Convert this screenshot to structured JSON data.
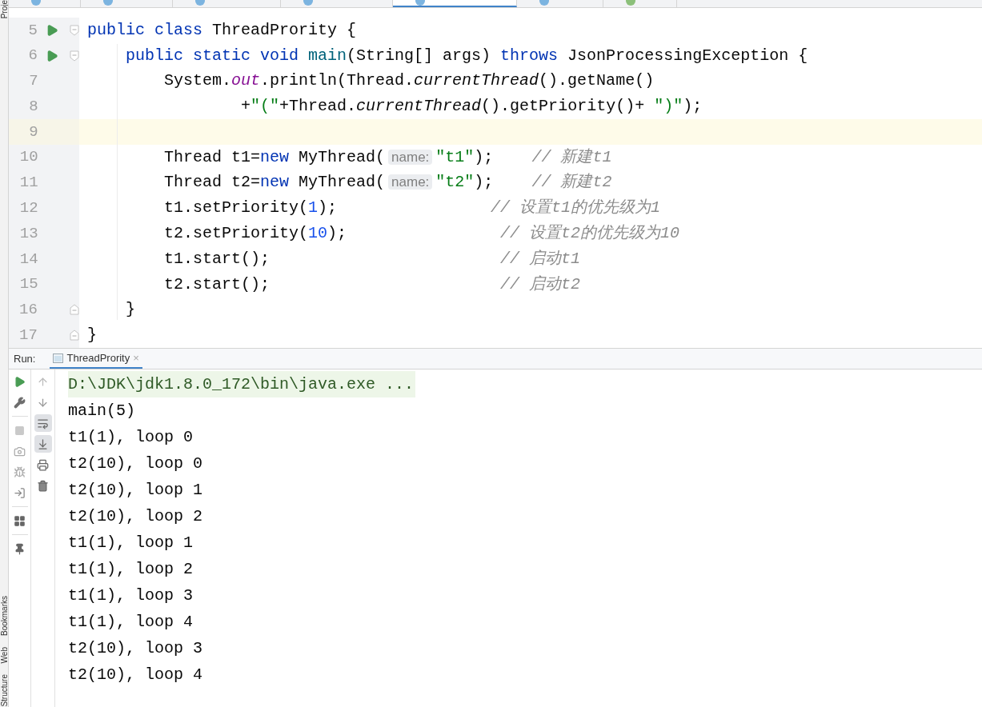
{
  "side_labels_top": [
    {
      "text": "Proje"
    }
  ],
  "side_labels_bottom": [
    {
      "text": "Bookmarks"
    },
    {
      "text": "Web"
    },
    {
      "text": "Structure"
    }
  ],
  "editor_tabs": [
    {
      "selected": false,
      "color": "#7cb4e0"
    },
    {
      "selected": false,
      "color": "#7cb4e0"
    },
    {
      "selected": false,
      "color": "#7cb4e0"
    },
    {
      "selected": false,
      "color": "#7cb4e0"
    },
    {
      "selected": true,
      "color": "#7cb4e0"
    },
    {
      "selected": false,
      "color": "#7cb4e0"
    },
    {
      "selected": false,
      "color": "#8cc07a"
    }
  ],
  "code_lines": [
    {
      "number": "5",
      "current": false,
      "run": true,
      "fold_open": true,
      "fold_close": false,
      "tokens": [
        {
          "kind": "keyword",
          "text": "public class "
        },
        {
          "kind": "plain",
          "text": "ThreadPrority {"
        }
      ]
    },
    {
      "number": "6",
      "current": false,
      "run": true,
      "fold_open": true,
      "fold_close": false,
      "tokens": [
        {
          "kind": "keyword",
          "text": "    public static void "
        },
        {
          "kind": "method",
          "text": "main"
        },
        {
          "kind": "plain",
          "text": "(String[] args) "
        },
        {
          "kind": "keyword",
          "text": "throws"
        },
        {
          "kind": "plain",
          "text": " JsonProcessingException {"
        }
      ]
    },
    {
      "number": "7",
      "current": false,
      "run": false,
      "fold_open": false,
      "fold_close": false,
      "tokens": [
        {
          "kind": "plain",
          "text": "        System."
        },
        {
          "kind": "field",
          "text": "out"
        },
        {
          "kind": "plain",
          "text": ".println(Thread."
        },
        {
          "kind": "static",
          "text": "currentThread"
        },
        {
          "kind": "plain",
          "text": "().getName()"
        }
      ]
    },
    {
      "number": "8",
      "current": false,
      "run": false,
      "fold_open": false,
      "fold_close": false,
      "tokens": [
        {
          "kind": "plain",
          "text": "                +"
        },
        {
          "kind": "string",
          "text": "\"(\""
        },
        {
          "kind": "plain",
          "text": "+Thread."
        },
        {
          "kind": "static",
          "text": "currentThread"
        },
        {
          "kind": "plain",
          "text": "().getPriority()+ "
        },
        {
          "kind": "string",
          "text": "\")\""
        },
        {
          "kind": "plain",
          "text": ");"
        }
      ]
    },
    {
      "number": "9",
      "current": true,
      "run": false,
      "fold_open": false,
      "fold_close": false
    },
    {
      "number": "10",
      "current": false,
      "run": false,
      "fold_open": false,
      "fold_close": false,
      "tokens": [
        {
          "kind": "plain",
          "text": "        Thread t1="
        },
        {
          "kind": "keyword",
          "text": "new "
        },
        {
          "kind": "plain",
          "text": "MyThread("
        },
        {
          "kind": "hint",
          "text": "name:"
        },
        {
          "kind": "string",
          "text": "\"t1\""
        },
        {
          "kind": "plain",
          "text": ");    "
        },
        {
          "kind": "comment",
          "text": "// 新建t1"
        }
      ]
    },
    {
      "number": "11",
      "current": false,
      "run": false,
      "fold_open": false,
      "fold_close": false,
      "tokens": [
        {
          "kind": "plain",
          "text": "        Thread t2="
        },
        {
          "kind": "keyword",
          "text": "new "
        },
        {
          "kind": "plain",
          "text": "MyThread("
        },
        {
          "kind": "hint",
          "text": "name:"
        },
        {
          "kind": "string",
          "text": "\"t2\""
        },
        {
          "kind": "plain",
          "text": ");    "
        },
        {
          "kind": "comment",
          "text": "// 新建t2"
        }
      ]
    },
    {
      "number": "12",
      "current": false,
      "run": false,
      "fold_open": false,
      "fold_close": false,
      "tokens": [
        {
          "kind": "plain",
          "text": "        t1.setPriority("
        },
        {
          "kind": "number",
          "text": "1"
        },
        {
          "kind": "plain",
          "text": ");                "
        },
        {
          "kind": "comment",
          "text": "// 设置t1的优先级为1"
        }
      ]
    },
    {
      "number": "13",
      "current": false,
      "run": false,
      "fold_open": false,
      "fold_close": false,
      "tokens": [
        {
          "kind": "plain",
          "text": "        t2.setPriority("
        },
        {
          "kind": "number",
          "text": "10"
        },
        {
          "kind": "plain",
          "text": ");                "
        },
        {
          "kind": "comment",
          "text": "// 设置t2的优先级为10"
        }
      ]
    },
    {
      "number": "14",
      "current": false,
      "run": false,
      "fold_open": false,
      "fold_close": false,
      "tokens": [
        {
          "kind": "plain",
          "text": "        t1.start();                        "
        },
        {
          "kind": "comment",
          "text": "// 启动t1"
        }
      ]
    },
    {
      "number": "15",
      "current": false,
      "run": false,
      "fold_open": false,
      "fold_close": false,
      "tokens": [
        {
          "kind": "plain",
          "text": "        t2.start();                        "
        },
        {
          "kind": "comment",
          "text": "// 启动t2"
        }
      ]
    },
    {
      "number": "16",
      "current": false,
      "run": false,
      "fold_open": false,
      "fold_close": true,
      "tokens": [
        {
          "kind": "plain",
          "text": "    }"
        }
      ]
    },
    {
      "number": "17",
      "current": false,
      "run": false,
      "fold_open": false,
      "fold_close": true,
      "tokens": [
        {
          "kind": "plain",
          "text": "}"
        }
      ]
    }
  ],
  "run_panel": {
    "label": "Run:",
    "tab": {
      "title": "ThreadPrority",
      "close": "×"
    },
    "soft_wrap_on": true,
    "scroll_to_end_on": true,
    "command": "D:\\JDK\\jdk1.8.0_172\\bin\\java.exe ...",
    "output": [
      "main(5)",
      "t1(1), loop 0",
      "t2(10), loop 0",
      "t2(10), loop 1",
      "t2(10), loop 2",
      "t1(1), loop 1",
      "t1(1), loop 2",
      "t1(1), loop 3",
      "t1(1), loop 4",
      "t2(10), loop 3",
      "t2(10), loop 4"
    ]
  }
}
